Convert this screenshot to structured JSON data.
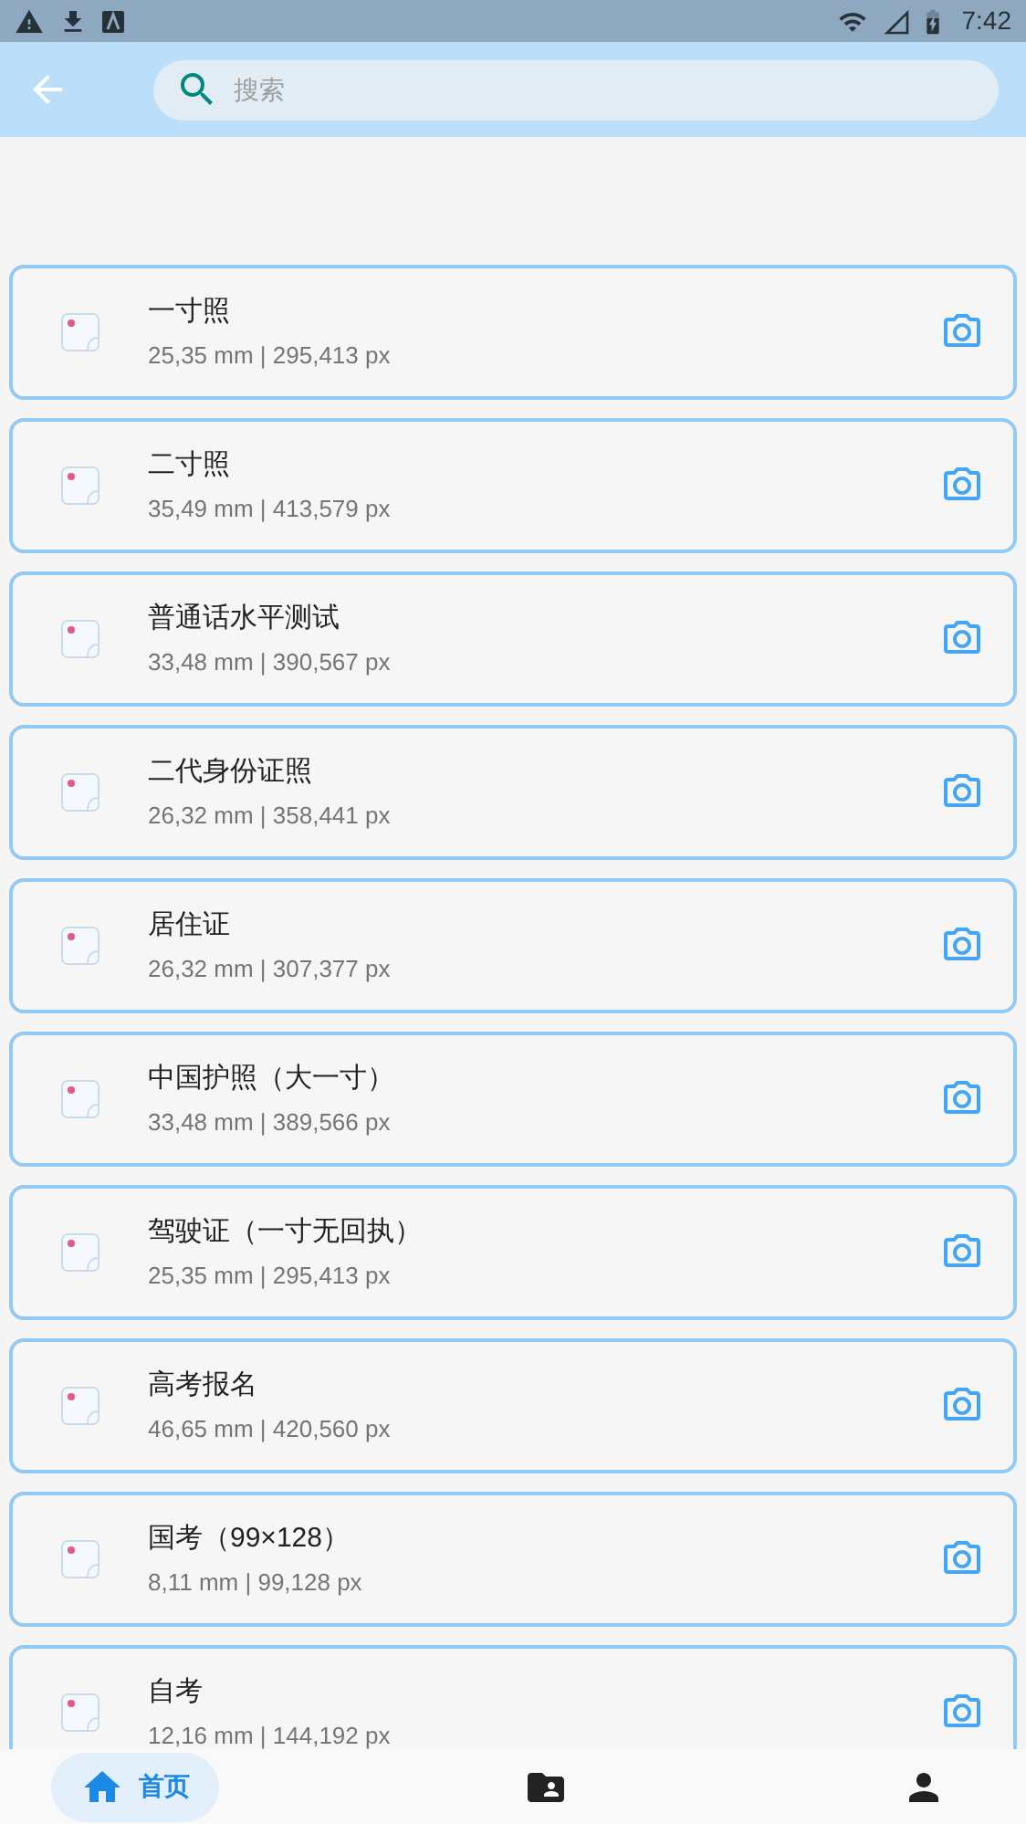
{
  "status_bar": {
    "time": "7:42"
  },
  "search": {
    "placeholder": "搜索"
  },
  "items": [
    {
      "title": "一寸照",
      "size": "25,35 mm | 295,413 px"
    },
    {
      "title": "二寸照",
      "size": "35,49 mm | 413,579 px"
    },
    {
      "title": "普通话水平测试",
      "size": "33,48 mm | 390,567 px"
    },
    {
      "title": "二代身份证照",
      "size": "26,32 mm | 358,441 px"
    },
    {
      "title": "居住证",
      "size": "26,32 mm | 307,377 px"
    },
    {
      "title": "中国护照（大一寸）",
      "size": "33,48 mm | 389,566 px"
    },
    {
      "title": "驾驶证（一寸无回执）",
      "size": "25,35 mm | 295,413 px"
    },
    {
      "title": "高考报名",
      "size": "46,65 mm | 420,560 px"
    },
    {
      "title": "国考（99×128）",
      "size": "8,11 mm | 99,128 px"
    },
    {
      "title": "自考",
      "size": "12,16 mm | 144,192 px"
    }
  ],
  "nav": [
    {
      "kind": "home",
      "label": "首页",
      "selected": true
    },
    {
      "kind": "folder",
      "selected": false
    },
    {
      "kind": "person",
      "selected": false
    }
  ]
}
